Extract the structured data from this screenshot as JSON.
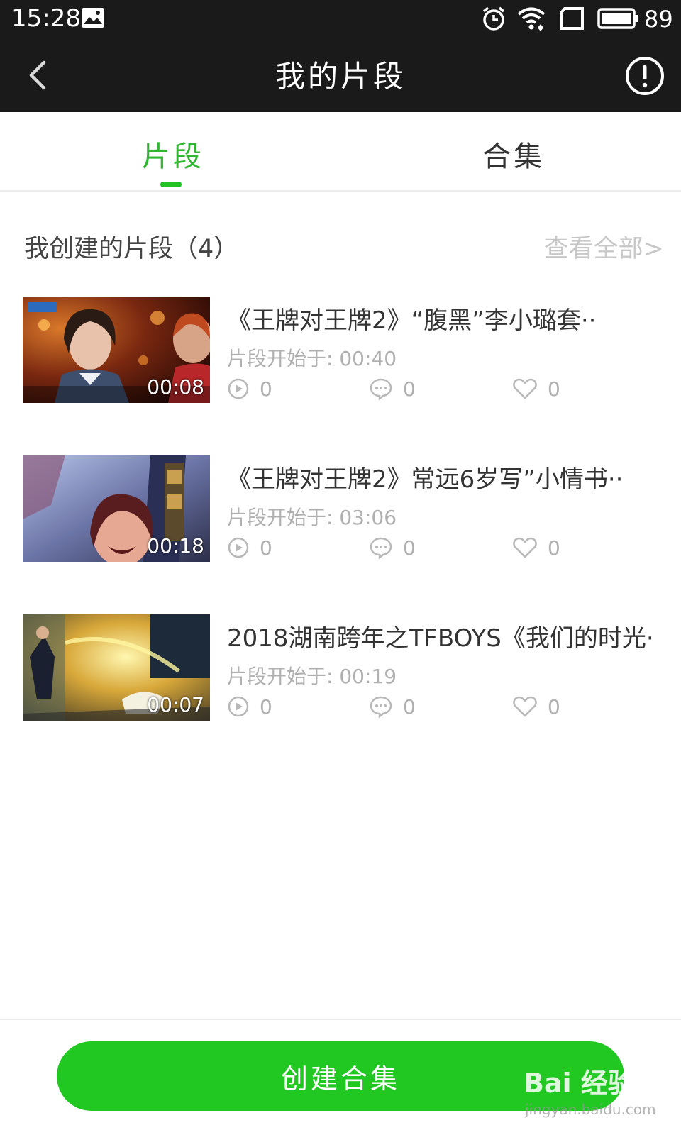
{
  "status_bar": {
    "time": "15:28",
    "battery": "89",
    "icons": [
      "image-icon",
      "alarm-icon",
      "wifi-icon",
      "sim-icon",
      "battery-icon"
    ]
  },
  "header": {
    "title": "我的片段",
    "back_icon": "chevron-left-icon",
    "info_icon": "info-icon"
  },
  "tabs": [
    {
      "label": "片段",
      "active": true
    },
    {
      "label": "合集",
      "active": false
    }
  ],
  "section": {
    "title": "我创建的片段（4）",
    "view_all": "查看全部>"
  },
  "clips": [
    {
      "title": "《王牌对王牌2》“腹黑”李小璐套··",
      "duration": "00:08",
      "start": "片段开始于: 00:40",
      "plays": "0",
      "comments": "0",
      "likes": "0"
    },
    {
      "title": "《王牌对王牌2》常远6岁写”小情书··",
      "duration": "00:18",
      "start": "片段开始于: 03:06",
      "plays": "0",
      "comments": "0",
      "likes": "0"
    },
    {
      "title": "2018湖南跨年之TFBOYS《我们的时光··",
      "duration": "00:07",
      "start": "片段开始于: 00:19",
      "plays": "0",
      "comments": "0",
      "likes": "0"
    }
  ],
  "footer": {
    "create_button": "创建合集"
  },
  "watermark": {
    "brand": "Bai 经验",
    "url": "jingyan.baidu.com"
  },
  "colors": {
    "accent": "#22c822",
    "header_bg": "#1a1a1a",
    "muted_text": "#b0b0b0"
  }
}
